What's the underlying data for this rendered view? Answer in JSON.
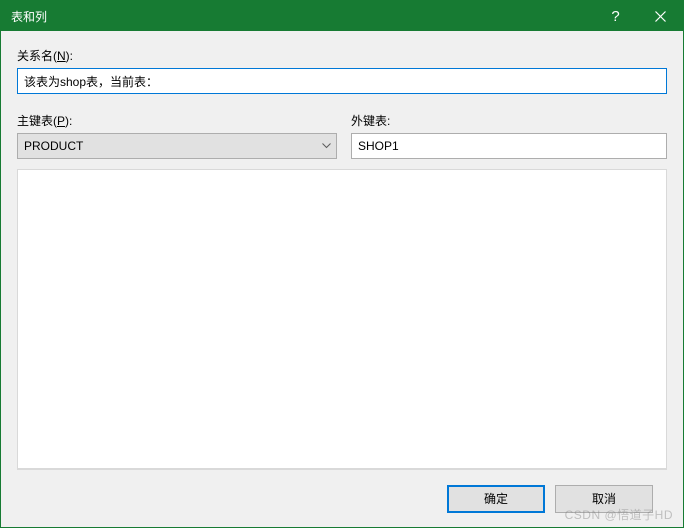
{
  "titlebar": {
    "title": "表和列",
    "help": "?",
    "close": "×"
  },
  "labels": {
    "relation_name": "关系名(",
    "relation_name_key": "N",
    "relation_name_suffix": "):",
    "primary_table": "主键表(",
    "primary_table_key": "P",
    "primary_table_suffix": "):",
    "foreign_table": "外键表:"
  },
  "fields": {
    "relation_name_value": "该表为shop表，当前表：",
    "primary_table_value": "PRODUCT",
    "foreign_table_value": "SHOP1"
  },
  "buttons": {
    "ok": "确定",
    "cancel": "取消"
  },
  "watermark": "CSDN @悟道子HD"
}
